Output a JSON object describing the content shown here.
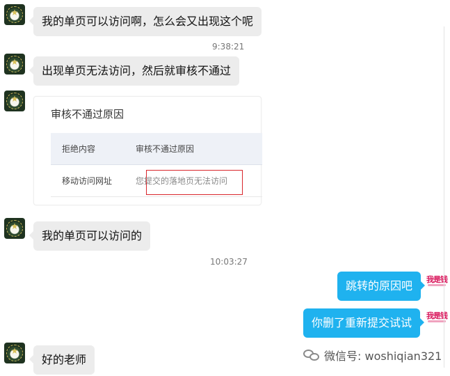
{
  "messages": [
    {
      "text": "我的单页可以访问啊，怎么会又出现这个呢"
    },
    {
      "text": "出现单页无法访问，然后就审核不通过"
    },
    {
      "text": "我的单页可以访问的"
    },
    {
      "text": "跳转的原因吧"
    },
    {
      "text": "你删了重新提交试试"
    },
    {
      "text": "好的老师"
    }
  ],
  "timestamps": [
    "9:38:21",
    "10:03:27"
  ],
  "review_card": {
    "title": "审核不通过原因",
    "headers": [
      "拒绝内容",
      "审核不通过原因"
    ],
    "row": [
      "移动访问网址",
      "您提交的落地页无法访问"
    ]
  },
  "brand_avatar_text": "我是钱",
  "watermark": {
    "label": "微信号: woshiqian321",
    "icon": "wechat-icon"
  },
  "colors": {
    "right_bubble": "#1fb2ef",
    "left_bubble": "#ececec",
    "highlight": "#d9252b"
  }
}
